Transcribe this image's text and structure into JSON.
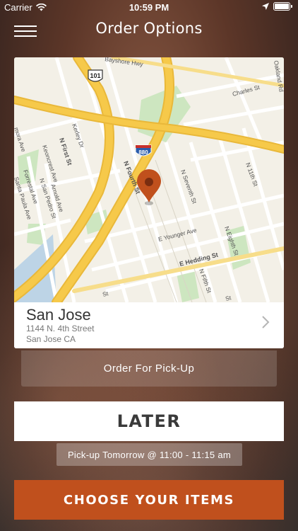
{
  "status_bar": {
    "carrier": "Carrier",
    "time": "10:59 PM",
    "icons": [
      "wifi-icon",
      "location-arrow-icon",
      "battery-icon"
    ]
  },
  "header": {
    "title": "Order Options",
    "menu_icon": "hamburger-menu-icon"
  },
  "map": {
    "highway_shield": "101",
    "interstate_shield": "880",
    "street_labels": [
      "Bayshore Hwy",
      "Oakland Rd",
      "Charles St",
      "Kerley Dr",
      "N First St",
      "Keoncrest Ave",
      "Arnold Ave",
      "N San Pedro St",
      "Forrestal Ave",
      "Santa Paula Ave",
      "N Fourth St",
      "N Seventh St",
      "N 11th St",
      "E Younger Ave",
      "N Eighth St",
      "E Hedding St",
      "N Fifth St",
      "St",
      "St",
      "mora Ave"
    ],
    "pin_icon": "map-pin-icon"
  },
  "location": {
    "city": "San Jose",
    "address_line1": "1144 N. 4th Street",
    "address_line2": "San Jose CA",
    "chevron_icon": "chevron-right-icon"
  },
  "order_mode": {
    "label": "Order For Pick-Up"
  },
  "timing": {
    "later_label": "LATER",
    "pickup_time": "Pick-up Tomorrow @ 11:00 - 11:15 am"
  },
  "cta": {
    "label": "CHOOSE YOUR ITEMS"
  },
  "colors": {
    "accent": "#c0501d",
    "map_road_major": "#f6c94a",
    "map_park": "#cde6c0",
    "pin": "#c0501d"
  }
}
